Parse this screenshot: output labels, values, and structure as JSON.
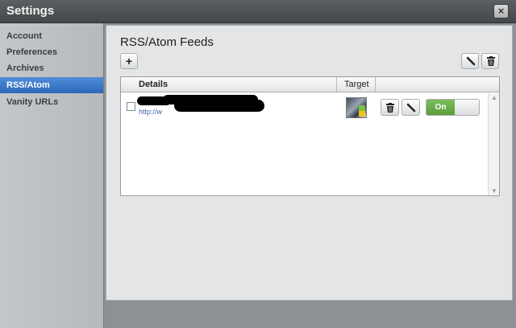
{
  "window": {
    "title": "Settings",
    "close_glyph": "×"
  },
  "sidebar": {
    "items": [
      {
        "label": "Account",
        "active": false
      },
      {
        "label": "Preferences",
        "active": false
      },
      {
        "label": "Archives",
        "active": false
      },
      {
        "label": "RSS/Atom",
        "active": true
      },
      {
        "label": "Vanity URLs",
        "active": false
      }
    ]
  },
  "main": {
    "title": "RSS/Atom Feeds",
    "toolbar": {
      "add_glyph": "+",
      "add_icon": "plus-icon",
      "edit_icon": "pencil-icon",
      "delete_icon": "trash-icon"
    },
    "table": {
      "columns": [
        "Details",
        "Target",
        ""
      ],
      "rows": [
        {
          "name": "[redacted]",
          "url": "http://w",
          "target_icon": "avatar-thumbnail",
          "status": "On"
        }
      ]
    }
  },
  "colors": {
    "accent": "#3b78c8",
    "toggle_on": "#6aad4a",
    "link": "#3a68a8"
  }
}
